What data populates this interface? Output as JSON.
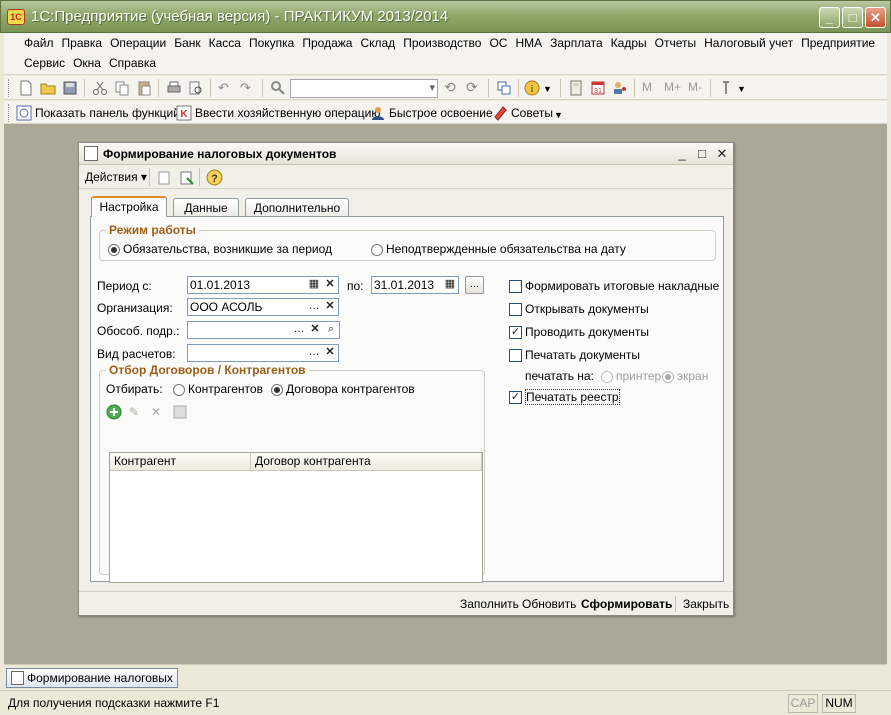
{
  "app": {
    "title": "1С:Предприятие (учебная версия) - ПРАКТИКУМ 2013/2014",
    "icon_text": "1С"
  },
  "menu": {
    "row1": [
      "Файл",
      "Правка",
      "Операции",
      "Банк",
      "Касса",
      "Покупка",
      "Продажа",
      "Склад",
      "Производство",
      "ОС",
      "НМА",
      "Зарплата",
      "Кадры",
      "Отчеты",
      "Налоговый учет",
      "Предприятие"
    ],
    "row2": [
      "Сервис",
      "Окна",
      "Справка"
    ]
  },
  "toolbar3": {
    "show_functions": "Показать панель функций",
    "enter_operation": "Ввести хозяйственную операцию",
    "quick_learning": "Быстрое освоение",
    "tips": "Советы"
  },
  "toolbar2": {
    "memory_buttons": [
      "M",
      "M+",
      "M-"
    ]
  },
  "dialog": {
    "title": "Формирование налоговых документов",
    "actions_label": "Действия",
    "tabs": [
      "Настройка",
      "Данные",
      "Дополнительно"
    ],
    "mode": {
      "legend": "Режим работы",
      "option1": "Обязательства, возникшие за период",
      "option2": "Неподтвержденные обязательства на дату"
    },
    "period_label": "Период с:",
    "period_from": "01.01.2013",
    "period_to_label": "по:",
    "period_to": "31.01.2013",
    "org_label": "Организация:",
    "org_value": "ООО АСОЛЬ",
    "subdivision_label": "Обособ. подр.:",
    "subdivision_value": "",
    "settlement_label": "Вид расчетов:",
    "settlement_value": "",
    "filter": {
      "legend": "Отбор Договоров / Контрагентов",
      "select_label": "Отбирать:",
      "option1": "Контрагентов",
      "option2": "Договора контрагентов",
      "columns": [
        "Контрагент",
        "Договор контрагента"
      ]
    },
    "checkboxes": {
      "summary_invoices": "Формировать итоговые накладные",
      "open_docs": "Открывать документы",
      "post_docs": "Проводить документы",
      "print_docs": "Печатать документы",
      "print_on_label": "печатать на:",
      "printer": "принтер",
      "screen": "экран",
      "print_registry": "Печатать реестр"
    },
    "footer": {
      "fill": "Заполнить",
      "refresh": "Обновить",
      "create": "Сформировать",
      "close": "Закрыть"
    }
  },
  "taskbar": {
    "item": "Формирование налоговых ..."
  },
  "status": {
    "hint": "Для получения подсказки нажмите F1",
    "cap": "CAP",
    "num": "NUM"
  },
  "colors": {
    "legend": "#9c5e18",
    "titlebar": "#90a86a",
    "active_tab_accent": "#e68b2c"
  }
}
